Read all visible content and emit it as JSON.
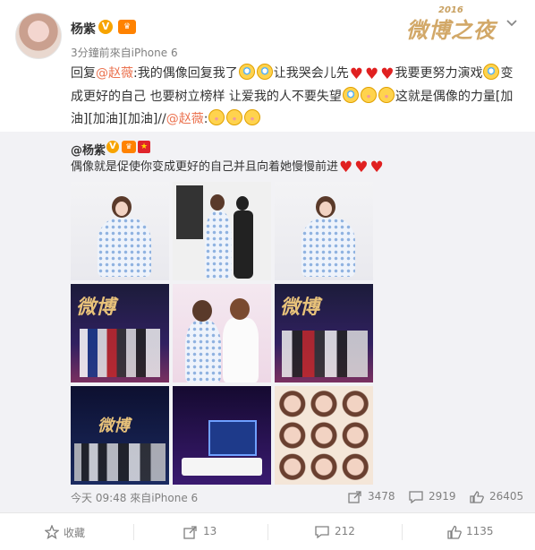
{
  "post": {
    "username": "杨紫",
    "verified_badge": "V",
    "meta": "3分鐘前來自iPhone 6",
    "event_logo": {
      "year": "2016",
      "name": "微博之夜"
    },
    "text": {
      "reply_prefix": "回复",
      "mention1": "@赵薇",
      "seg1": ":我的偶像回复我了",
      "seg2": "让我哭会儿先",
      "seg3": "我要更努力演戏",
      "seg4": "变成更好的自己 也要树立榜样 让爱我的人不要失望",
      "seg5": "这就是偶像的力量[加油][加油][加油]//",
      "mention2": "@赵薇",
      "colon": ":"
    }
  },
  "repost": {
    "username": "@杨紫",
    "text": "偶像就是促使你变成更好的自己并且向着她慢慢前进",
    "footer": {
      "time": "今天 09:48 來自iPhone 6",
      "shares": "3478",
      "comments": "2919",
      "likes": "26405"
    }
  },
  "actions": {
    "favorite": "收藏",
    "repost": "13",
    "comment": "212",
    "like": "1135"
  },
  "colors": {
    "accent": "#eb7350",
    "meta": "#808080",
    "repost_bg": "#f2f2f5"
  }
}
